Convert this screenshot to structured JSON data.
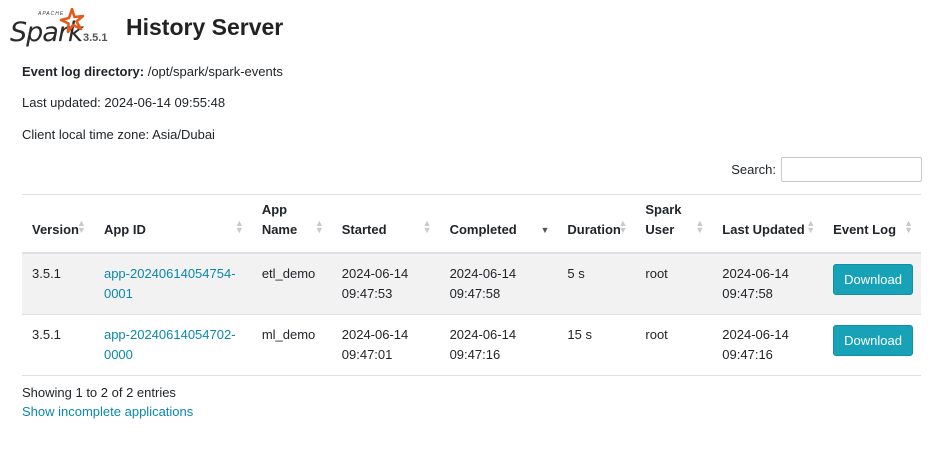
{
  "app": {
    "logo_apache": "APACHE",
    "logo_spark": "Spark",
    "version": "3.5.1",
    "title": "History Server"
  },
  "info": {
    "dir_label": "Event log directory:",
    "dir_value": "/opt/spark/spark-events",
    "updated": "Last updated: 2024-06-14 09:55:48",
    "timezone": "Client local time zone: Asia/Dubai"
  },
  "search": {
    "label": "Search:",
    "value": ""
  },
  "table": {
    "columns": [
      {
        "label": "Version",
        "sort": "none"
      },
      {
        "label": "App ID",
        "sort": "none"
      },
      {
        "label": "App Name",
        "sort": "none"
      },
      {
        "label": "Started",
        "sort": "none"
      },
      {
        "label": "Completed",
        "sort": "desc"
      },
      {
        "label": "Duration",
        "sort": "none"
      },
      {
        "label": "Spark User",
        "sort": "none"
      },
      {
        "label": "Last Updated",
        "sort": "none"
      },
      {
        "label": "Event Log",
        "sort": "none"
      }
    ],
    "rows": [
      {
        "version": "3.5.1",
        "app_id_1": "app-20240614054754-",
        "app_id_2": "0001",
        "app_name": "etl_demo",
        "started_1": "2024-06-14",
        "started_2": "09:47:53",
        "completed_1": "2024-06-14",
        "completed_2": "09:47:58",
        "duration": "5 s",
        "user": "root",
        "last_1": "2024-06-14",
        "last_2": "09:47:58",
        "action": "Download"
      },
      {
        "version": "3.5.1",
        "app_id_1": "app-20240614054702-",
        "app_id_2": "0000",
        "app_name": "ml_demo",
        "started_1": "2024-06-14",
        "started_2": "09:47:01",
        "completed_1": "2024-06-14",
        "completed_2": "09:47:16",
        "duration": "15 s",
        "user": "root",
        "last_1": "2024-06-14",
        "last_2": "09:47:16",
        "action": "Download"
      }
    ]
  },
  "footer": {
    "showing": "Showing 1 to 2 of 2 entries",
    "incomplete_link": "Show incomplete applications"
  },
  "colors": {
    "accent": "#17a2b8",
    "link": "#0a88ad",
    "logo_star": "#e25a1c"
  }
}
